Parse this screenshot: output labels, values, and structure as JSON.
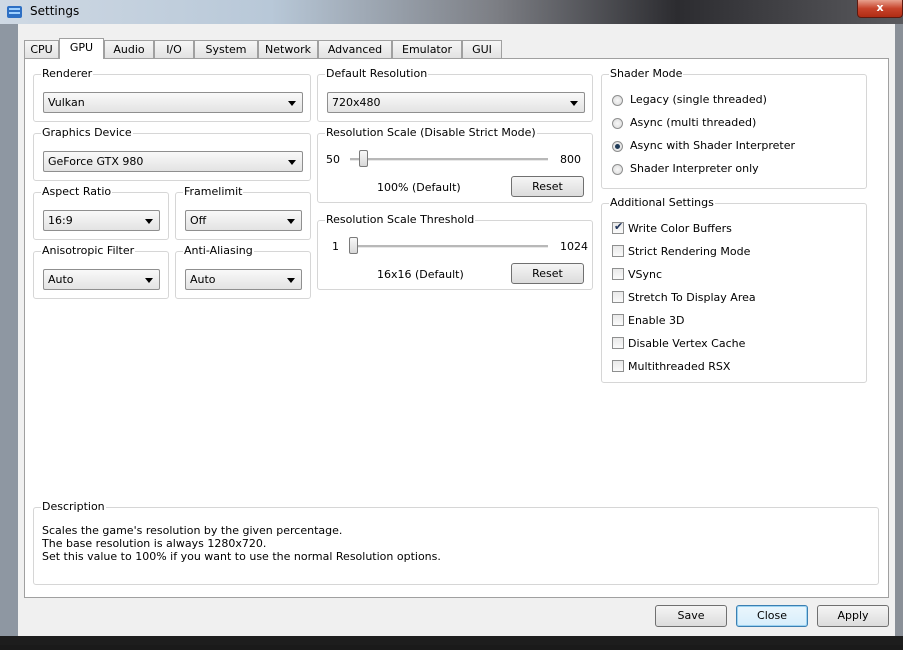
{
  "window": {
    "title": "Settings",
    "close_glyph": "x"
  },
  "tabs": [
    {
      "label": "CPU"
    },
    {
      "label": "GPU"
    },
    {
      "label": "Audio"
    },
    {
      "label": "I/O"
    },
    {
      "label": "System"
    },
    {
      "label": "Network"
    },
    {
      "label": "Advanced"
    },
    {
      "label": "Emulator"
    },
    {
      "label": "GUI"
    }
  ],
  "active_tab": "GPU",
  "renderer": {
    "title": "Renderer",
    "value": "Vulkan"
  },
  "graphics_device": {
    "title": "Graphics Device",
    "value": "GeForce GTX 980"
  },
  "aspect_ratio": {
    "title": "Aspect Ratio",
    "value": "16:9"
  },
  "framelimit": {
    "title": "Framelimit",
    "value": "Off"
  },
  "anisotropic": {
    "title": "Anisotropic Filter",
    "value": "Auto"
  },
  "anti_aliasing": {
    "title": "Anti-Aliasing",
    "value": "Auto"
  },
  "default_resolution": {
    "title": "Default Resolution",
    "value": "720x480"
  },
  "resolution_scale": {
    "title": "Resolution Scale (Disable Strict Mode)",
    "min": "50",
    "max": "800",
    "value_text": "100% (Default)",
    "fraction": 0.067,
    "reset_label": "Reset"
  },
  "scale_threshold": {
    "title": "Resolution Scale Threshold",
    "min": "1",
    "max": "1024",
    "value_text": "16x16 (Default)",
    "fraction": 0.015,
    "reset_label": "Reset"
  },
  "shader_mode": {
    "title": "Shader Mode",
    "options": [
      {
        "label": "Legacy (single threaded)",
        "selected": false
      },
      {
        "label": "Async (multi threaded)",
        "selected": false
      },
      {
        "label": "Async with Shader Interpreter",
        "selected": true
      },
      {
        "label": "Shader Interpreter only",
        "selected": false
      }
    ]
  },
  "additional": {
    "title": "Additional Settings",
    "items": [
      {
        "label": "Write Color Buffers",
        "checked": true
      },
      {
        "label": "Strict Rendering Mode",
        "checked": false
      },
      {
        "label": "VSync",
        "checked": false
      },
      {
        "label": "Stretch To Display Area",
        "checked": false
      },
      {
        "label": "Enable 3D",
        "checked": false
      },
      {
        "label": "Disable Vertex Cache",
        "checked": false
      },
      {
        "label": "Multithreaded RSX",
        "checked": false
      }
    ]
  },
  "description": {
    "title": "Description",
    "lines": [
      "Scales the game's resolution by the given percentage.",
      "The base resolution is always 1280x720.",
      "Set this value to 100% if you want to use the normal Resolution options."
    ]
  },
  "footer": {
    "save": "Save",
    "close": "Close",
    "apply": "Apply"
  },
  "check_glyph": "✔"
}
